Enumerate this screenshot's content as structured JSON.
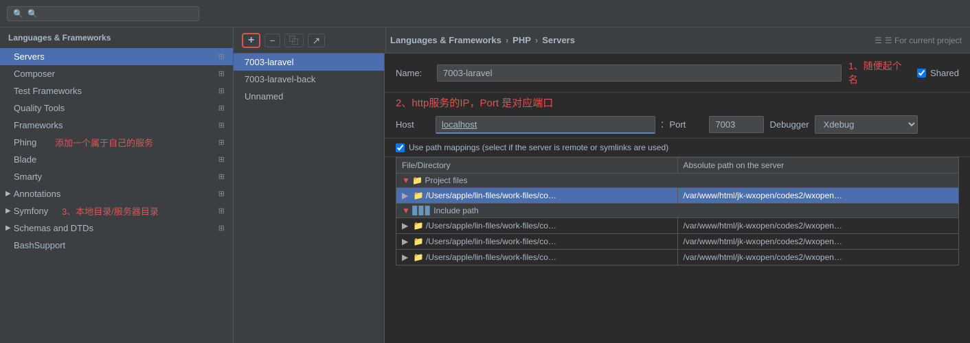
{
  "topBar": {
    "searchPlaceholder": "🔍"
  },
  "breadcrumb": {
    "part1": "Languages & Frameworks",
    "sep1": "›",
    "part2": "PHP",
    "sep2": "›",
    "part3": "Servers",
    "projectLabel": "☰ For current project"
  },
  "toolbar": {
    "addLabel": "+",
    "removeLabel": "−",
    "copyLabel": "⿻",
    "exportLabel": "↗"
  },
  "sidebar": {
    "title": "Languages & Frameworks",
    "items": [
      {
        "label": "Servers",
        "active": true,
        "hasIcon": true
      },
      {
        "label": "Composer",
        "hasIcon": true
      },
      {
        "label": "Test Frameworks",
        "hasIcon": true
      },
      {
        "label": "Quality Tools",
        "hasIcon": true
      },
      {
        "label": "Frameworks",
        "hasIcon": true
      },
      {
        "label": "Phing",
        "hasIcon": true
      },
      {
        "label": "Blade",
        "hasIcon": true
      },
      {
        "label": "Smarty",
        "hasIcon": true
      },
      {
        "label": "▶ Annotations",
        "hasIcon": true,
        "isGroup": true
      },
      {
        "label": "▶ Symfony",
        "hasIcon": true,
        "isGroup": true
      },
      {
        "label": "▶ Schemas and DTDs",
        "hasIcon": true,
        "isGroup": true
      },
      {
        "label": "BashSupport",
        "hasIcon": true
      }
    ]
  },
  "serverList": {
    "items": [
      {
        "label": "7003-laravel",
        "selected": true
      },
      {
        "label": "7003-laravel-back"
      },
      {
        "label": "Unnamed"
      }
    ]
  },
  "config": {
    "nameLabel": "Name:",
    "nameValue": "7003-laravel",
    "annotation1": "1、随便起个名",
    "annotation2": "2、http服务的IP，Port 是对应端口",
    "annotation3": "添加一个属于自己的服务",
    "annotation4": "3、本地目录/服务器目录",
    "hostLabel": "Host",
    "hostValue": "localhost",
    "portLabel": "Port",
    "portValue": "7003",
    "debuggerLabel": "Debugger",
    "debuggerValue": "Xdebug",
    "sharedLabel": "Shared",
    "pathMappingCheckboxLabel": "Use path mappings (select if the server is remote or symlinks are used)",
    "tableHeaders": {
      "fileDir": "File/Directory",
      "absPath": "Absolute path on the server"
    },
    "projectFilesSection": "Project files",
    "projectFilesRow": {
      "local": "/Users/apple/lin-files/work-files/co…",
      "remote": "/var/www/html/jk-wxopen/codes2/wxopen…"
    },
    "includePathSection": "Include path",
    "includePathRows": [
      {
        "local": "/Users/apple/lin-files/work-files/co…",
        "remote": "/var/www/html/jk-wxopen/codes2/wxopen…"
      },
      {
        "local": "/Users/apple/lin-files/work-files/co…",
        "remote": "/var/www/html/jk-wxopen/codes2/wxopen…"
      },
      {
        "local": "/Users/apple/lin-files/work-files/co…",
        "remote": "/var/www/html/jk-wxopen/codes2/wxopen…"
      }
    ]
  }
}
